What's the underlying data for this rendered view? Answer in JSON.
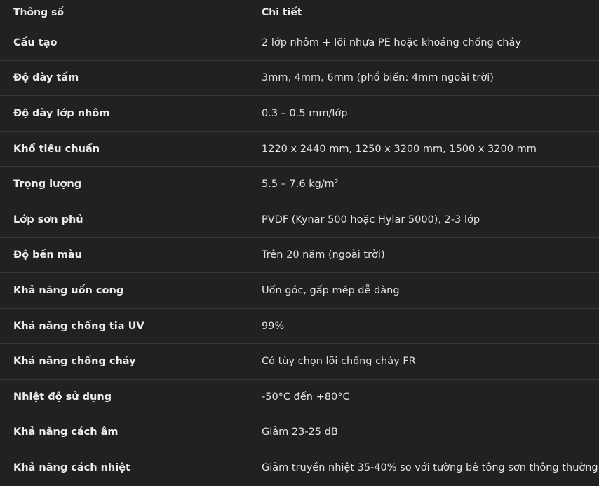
{
  "table": {
    "headers": [
      "Thông số",
      "Chi tiết"
    ],
    "rows": [
      {
        "param": "Cấu tạo",
        "detail": "2 lớp nhôm + lõi nhựa PE hoặc khoáng chống cháy"
      },
      {
        "param": "Độ dày tấm",
        "detail": "3mm, 4mm, 6mm (phổ biến: 4mm ngoài trời)"
      },
      {
        "param": "Độ dày lớp nhôm",
        "detail": "0.3 – 0.5 mm/lớp"
      },
      {
        "param": "Khổ tiêu chuẩn",
        "detail": "1220 x 2440 mm, 1250 x 3200 mm, 1500 x 3200 mm"
      },
      {
        "param": "Trọng lượng",
        "detail": "5.5 – 7.6 kg/m²"
      },
      {
        "param": "Lớp sơn phủ",
        "detail": "PVDF (Kynar 500 hoặc Hylar 5000), 2-3 lớp"
      },
      {
        "param": "Độ bền màu",
        "detail": "Trên 20 năm (ngoài trời)"
      },
      {
        "param": "Khả năng uốn cong",
        "detail": "Uốn góc, gấp mép dễ dàng"
      },
      {
        "param": "Khả năng chống tia UV",
        "detail": "99%"
      },
      {
        "param": "Khả năng chống cháy",
        "detail": "Có tùy chọn lõi chống cháy FR"
      },
      {
        "param": "Nhiệt độ sử dụng",
        "detail": "-50°C đến +80°C"
      },
      {
        "param": "Khả năng cách âm",
        "detail": "Giảm 23-25 dB"
      },
      {
        "param": "Khả năng cách nhiệt",
        "detail": "Giảm truyền nhiệt 35-40% so với tường bê tông sơn thông thường"
      }
    ]
  }
}
